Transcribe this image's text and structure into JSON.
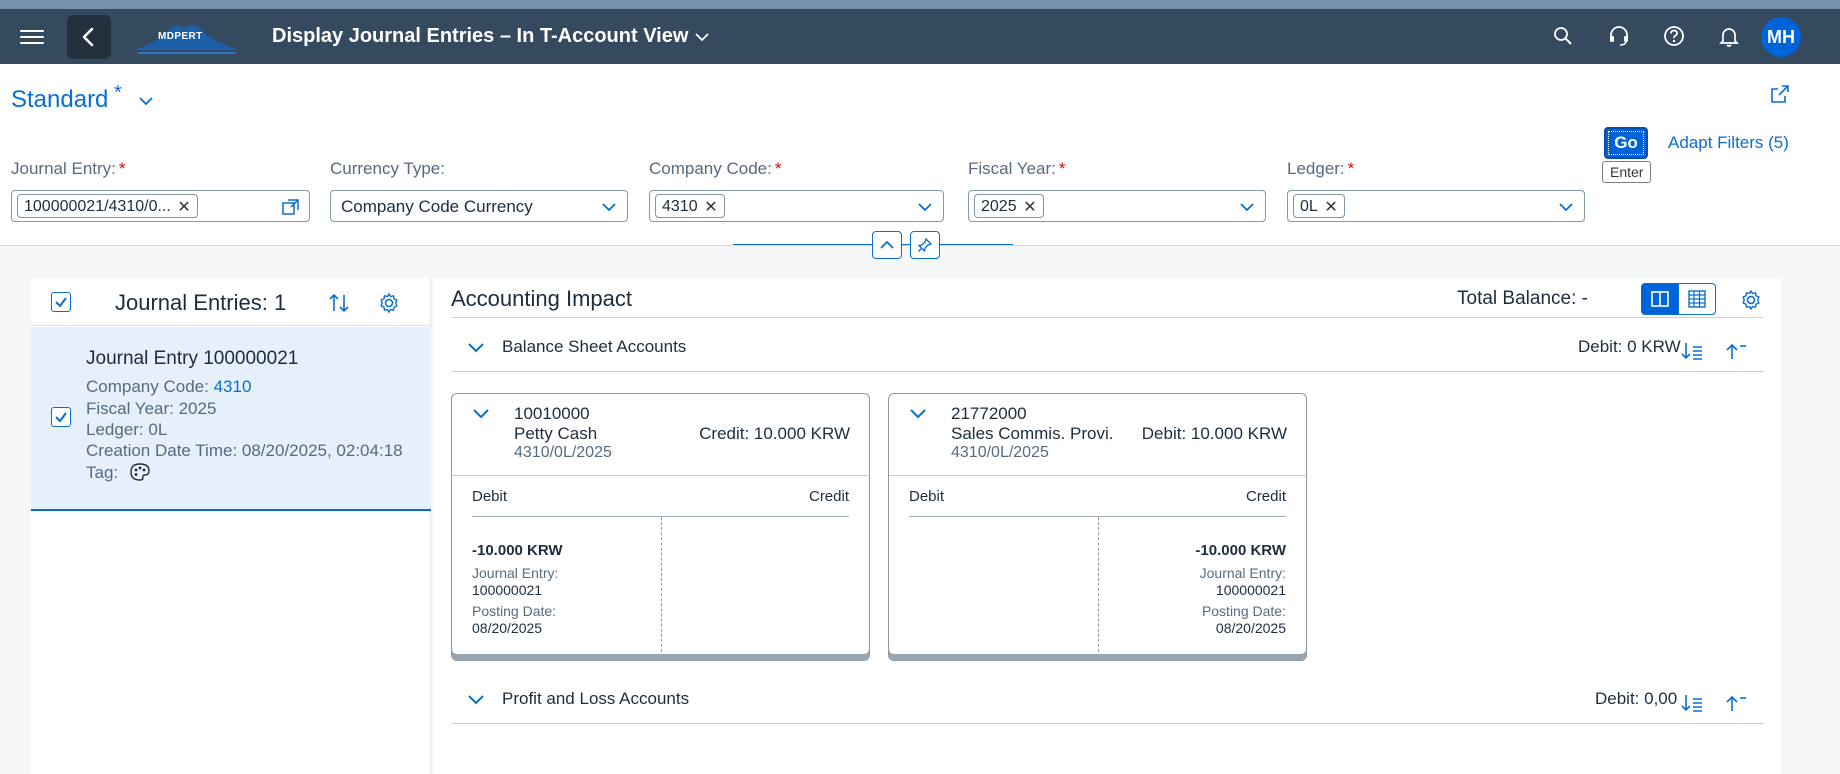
{
  "shell": {
    "title": "Display Journal Entries – In T-Account View",
    "logo_text": "MDPERT",
    "avatar_initials": "MH"
  },
  "variant": {
    "name": "Standard",
    "modified_marker": "*"
  },
  "filters": {
    "journal_entry": {
      "label": "Journal Entry:",
      "required": "*",
      "token": "100000021/4310/0..."
    },
    "currency_type": {
      "label": "Currency Type:",
      "value": "Company Code Currency"
    },
    "company_code": {
      "label": "Company Code:",
      "required": "*",
      "token": "4310"
    },
    "fiscal_year": {
      "label": "Fiscal Year:",
      "required": "*",
      "token": "2025"
    },
    "ledger": {
      "label": "Ledger:",
      "required": "*",
      "token": "0L"
    },
    "go_label": "Go",
    "go_tooltip": "Enter",
    "adapt_label": "Adapt Filters (5)",
    "token_remove_glyph": "✕"
  },
  "journal_list": {
    "title": "Journal Entries: 1",
    "items": [
      {
        "title": "Journal Entry 100000021",
        "company_code_label": "Company Code:",
        "company_code": "4310",
        "fiscal_year": "Fiscal Year: 2025",
        "ledger": "Ledger: 0L",
        "creation": "Creation Date Time: 08/20/2025, 02:04:18",
        "tag_label": "Tag:"
      }
    ]
  },
  "accounting_impact": {
    "title": "Accounting Impact",
    "total_balance": "Total Balance: -",
    "sections": [
      {
        "title": "Balance Sheet Accounts",
        "debit": "Debit: 0 KRW"
      },
      {
        "title": "Profit and Loss Accounts",
        "debit": "Debit: 0,00"
      }
    ],
    "t_accounts": [
      {
        "account": "10010000",
        "name": "Petty Cash",
        "sub": "4310/0L/2025",
        "balance": "Credit: 10.000 KRW",
        "debit_header": "Debit",
        "credit_header": "Credit",
        "entry": {
          "side": "debit",
          "amount": "-10.000 KRW",
          "je_label": "Journal Entry:",
          "je_value": "100000021",
          "pd_label": "Posting Date:",
          "pd_value": "08/20/2025"
        }
      },
      {
        "account": "21772000",
        "name": "Sales Commis. Provi.",
        "sub": "4310/0L/2025",
        "balance": "Debit: 10.000 KRW",
        "debit_header": "Debit",
        "credit_header": "Credit",
        "entry": {
          "side": "credit",
          "amount": "-10.000 KRW",
          "je_label": "Journal Entry:",
          "je_value": "100000021",
          "pd_label": "Posting Date:",
          "pd_value": "08/20/2025"
        }
      }
    ]
  },
  "colors": {
    "shell_bg": "#354a5f",
    "accent": "#0a6ed1",
    "selected_bg": "#e5f0fa",
    "required": "#ee0000"
  },
  "icons": [
    "menu-icon",
    "back-icon",
    "chevron-down-icon",
    "search-icon",
    "headset-icon",
    "help-icon",
    "bell-icon",
    "share-icon",
    "value-help-icon",
    "collapse-header-icon",
    "pin-icon",
    "sort-icon",
    "settings-icon",
    "split-view-icon",
    "grid-view-icon",
    "palette-icon",
    "sort-descending-icon",
    "collapse-all-icon"
  ]
}
